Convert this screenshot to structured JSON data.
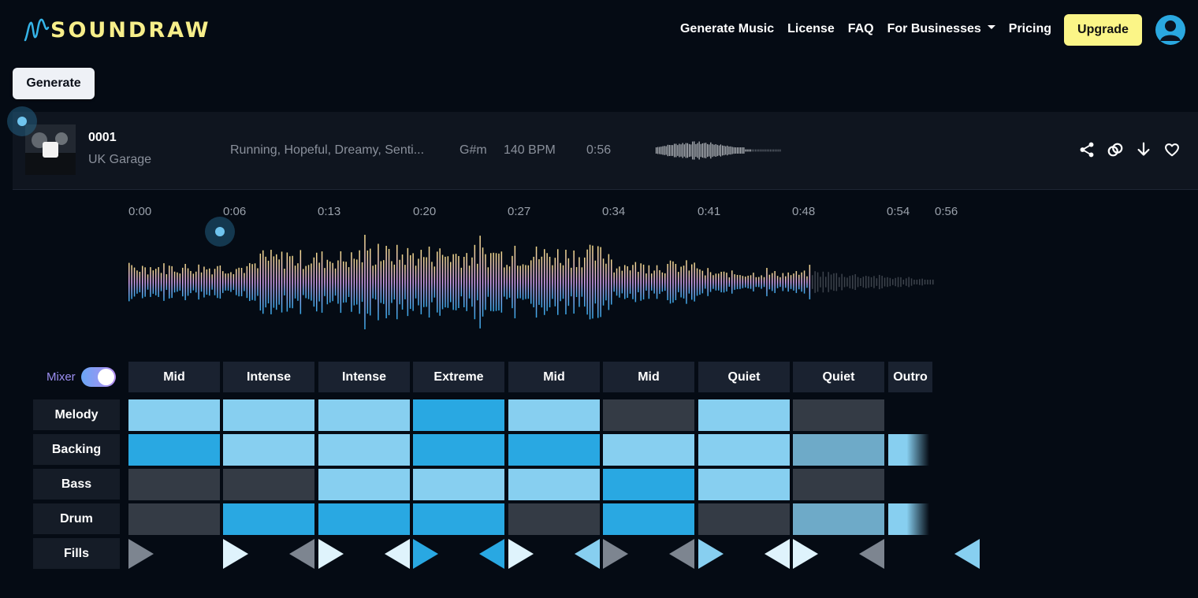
{
  "brand": {
    "name": "SOUNDRAW",
    "logo_color": "#f7ee8a"
  },
  "nav": {
    "items": [
      "Generate Music",
      "License",
      "FAQ",
      "For Businesses",
      "Pricing"
    ],
    "upgrade_label": "Upgrade",
    "upgrade_color": "#fbf587"
  },
  "toolbar": {
    "generate_label": "Generate"
  },
  "track": {
    "id": "0001",
    "genre": "UK Garage",
    "moods": "Running, Hopeful, Dreamy, Senti...",
    "key": "G#m",
    "bpm": "140 BPM",
    "duration": "0:56"
  },
  "playback": {
    "position_fraction": 0.125
  },
  "timeline": {
    "ticks": [
      "0:00",
      "0:06",
      "0:13",
      "0:20",
      "0:27",
      "0:34",
      "0:41",
      "0:48",
      "0:54",
      "0:56"
    ],
    "played_fraction": 0.845
  },
  "mixer": {
    "label": "Mixer",
    "enabled": true,
    "sections": [
      "Mid",
      "Intense",
      "Intense",
      "Extreme",
      "Mid",
      "Mid",
      "Quiet",
      "Quiet",
      "Outro"
    ],
    "tracks": [
      {
        "name": "Melody",
        "levels": [
          "light",
          "light",
          "light",
          "strong",
          "light",
          "off",
          "light",
          "off",
          "none"
        ]
      },
      {
        "name": "Backing",
        "levels": [
          "strong",
          "light",
          "light",
          "strong",
          "strong",
          "light",
          "light",
          "muted",
          "fade"
        ]
      },
      {
        "name": "Bass",
        "levels": [
          "off",
          "off",
          "light",
          "light",
          "light",
          "strong",
          "light",
          "off",
          "none"
        ]
      },
      {
        "name": "Drum",
        "levels": [
          "off",
          "strong",
          "strong",
          "strong",
          "off",
          "strong",
          "off",
          "muted",
          "fade"
        ]
      }
    ],
    "fills_label": "Fills",
    "fills": [
      {
        "in": "none",
        "out": "gray"
      },
      {
        "in": "gray",
        "out": "white"
      },
      {
        "in": "white",
        "out": "white"
      },
      {
        "in": "blue",
        "out": "blue"
      },
      {
        "in": "light",
        "out": "white"
      },
      {
        "in": "gray",
        "out": "gray"
      },
      {
        "in": "white",
        "out": "light"
      },
      {
        "in": "gray",
        "out": "white"
      },
      {
        "in": "light",
        "out": "none"
      }
    ],
    "colors": {
      "light": "#87cff0",
      "strong": "#29a8e2",
      "off": "#343b45",
      "muted": "#6eaac8",
      "fill_gray": "#7d8590",
      "fill_white": "#dff3fc",
      "fill_blue": "#29a8e2",
      "fill_light": "#87cff0"
    }
  }
}
